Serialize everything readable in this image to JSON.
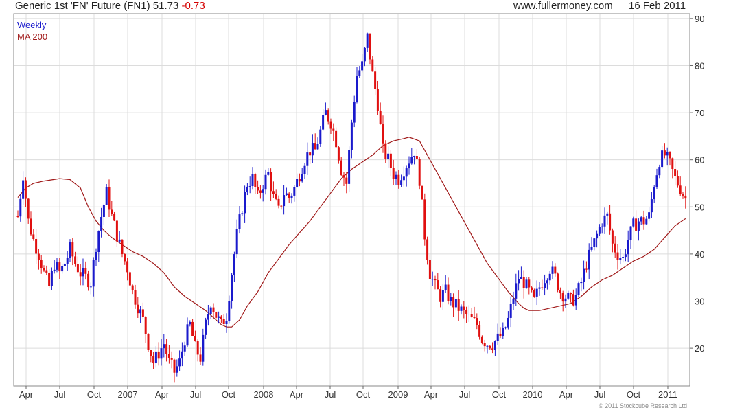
{
  "header": {
    "title_prefix": "Generic 1st 'FN' Future (FN1) 51.73",
    "title_change": "-0.73",
    "website": "www.fullermoney.com",
    "date": "16 Feb 2011"
  },
  "footer": {
    "copyright": "© 2011 Stockcube Research Ltd"
  },
  "colors": {
    "up": "#1a1acc",
    "down": "#e01010",
    "ma": "#a01818",
    "grid": "#dcdcdc",
    "legend_weekly": "#1a1acc",
    "legend_ma": "#a01818"
  },
  "chart_data": {
    "type": "candlestick",
    "legend": [
      "Weekly",
      "MA 200"
    ],
    "x_tick_labels": [
      "Apr",
      "Jul",
      "Oct",
      "2007",
      "Apr",
      "Jul",
      "Oct",
      "2008",
      "Apr",
      "Jul",
      "Oct",
      "2009",
      "Apr",
      "Jul",
      "Oct",
      "2010",
      "Apr",
      "Jul",
      "Oct",
      "2011"
    ],
    "y_ticks": [
      20,
      30,
      40,
      50,
      60,
      70,
      80,
      90
    ],
    "ylim": [
      12,
      91
    ],
    "grid": true,
    "last_close": 51.73,
    "change": -0.73,
    "weeks_total": 257,
    "close_series": [
      {
        "w": 0,
        "c": 48
      },
      {
        "w": 2,
        "c": 57
      },
      {
        "w": 4,
        "c": 47
      },
      {
        "w": 6,
        "c": 43
      },
      {
        "w": 8,
        "c": 40
      },
      {
        "w": 10,
        "c": 36
      },
      {
        "w": 12,
        "c": 33
      },
      {
        "w": 14,
        "c": 38
      },
      {
        "w": 16,
        "c": 36
      },
      {
        "w": 18,
        "c": 38
      },
      {
        "w": 20,
        "c": 41
      },
      {
        "w": 22,
        "c": 38
      },
      {
        "w": 24,
        "c": 36
      },
      {
        "w": 26,
        "c": 35
      },
      {
        "w": 28,
        "c": 34
      },
      {
        "w": 30,
        "c": 42
      },
      {
        "w": 32,
        "c": 48
      },
      {
        "w": 34,
        "c": 53
      },
      {
        "w": 36,
        "c": 48
      },
      {
        "w": 38,
        "c": 44
      },
      {
        "w": 40,
        "c": 40
      },
      {
        "w": 42,
        "c": 37
      },
      {
        "w": 44,
        "c": 32
      },
      {
        "w": 46,
        "c": 29
      },
      {
        "w": 48,
        "c": 26
      },
      {
        "w": 50,
        "c": 21
      },
      {
        "w": 52,
        "c": 17
      },
      {
        "w": 54,
        "c": 19
      },
      {
        "w": 56,
        "c": 21
      },
      {
        "w": 58,
        "c": 17
      },
      {
        "w": 60,
        "c": 15
      },
      {
        "w": 62,
        "c": 17
      },
      {
        "w": 64,
        "c": 22
      },
      {
        "w": 66,
        "c": 25
      },
      {
        "w": 68,
        "c": 20
      },
      {
        "w": 70,
        "c": 18
      },
      {
        "w": 72,
        "c": 25
      },
      {
        "w": 74,
        "c": 30
      },
      {
        "w": 76,
        "c": 27
      },
      {
        "w": 78,
        "c": 25
      },
      {
        "w": 80,
        "c": 27
      },
      {
        "w": 82,
        "c": 36
      },
      {
        "w": 84,
        "c": 44
      },
      {
        "w": 86,
        "c": 50
      },
      {
        "w": 88,
        "c": 55
      },
      {
        "w": 90,
        "c": 56
      },
      {
        "w": 92,
        "c": 52
      },
      {
        "w": 94,
        "c": 55
      },
      {
        "w": 96,
        "c": 57
      },
      {
        "w": 98,
        "c": 52
      },
      {
        "w": 100,
        "c": 49
      },
      {
        "w": 102,
        "c": 53
      },
      {
        "w": 104,
        "c": 52
      },
      {
        "w": 106,
        "c": 54
      },
      {
        "w": 108,
        "c": 57
      },
      {
        "w": 110,
        "c": 60
      },
      {
        "w": 112,
        "c": 62
      },
      {
        "w": 114,
        "c": 62
      },
      {
        "w": 116,
        "c": 66
      },
      {
        "w": 118,
        "c": 70
      },
      {
        "w": 120,
        "c": 68
      },
      {
        "w": 122,
        "c": 64
      },
      {
        "w": 124,
        "c": 58
      },
      {
        "w": 126,
        "c": 55
      },
      {
        "w": 128,
        "c": 68
      },
      {
        "w": 130,
        "c": 78
      },
      {
        "w": 132,
        "c": 80
      },
      {
        "w": 134,
        "c": 86
      },
      {
        "w": 136,
        "c": 78
      },
      {
        "w": 138,
        "c": 72
      },
      {
        "w": 140,
        "c": 62
      },
      {
        "w": 142,
        "c": 60
      },
      {
        "w": 144,
        "c": 57
      },
      {
        "w": 146,
        "c": 56
      },
      {
        "w": 148,
        "c": 58
      },
      {
        "w": 150,
        "c": 60
      },
      {
        "w": 152,
        "c": 62
      },
      {
        "w": 154,
        "c": 56
      },
      {
        "w": 156,
        "c": 44
      },
      {
        "w": 158,
        "c": 36
      },
      {
        "w": 160,
        "c": 33
      },
      {
        "w": 162,
        "c": 31
      },
      {
        "w": 164,
        "c": 32
      },
      {
        "w": 166,
        "c": 30
      },
      {
        "w": 168,
        "c": 29
      },
      {
        "w": 170,
        "c": 28
      },
      {
        "w": 172,
        "c": 27
      },
      {
        "w": 174,
        "c": 26
      },
      {
        "w": 176,
        "c": 25
      },
      {
        "w": 178,
        "c": 22
      },
      {
        "w": 180,
        "c": 21
      },
      {
        "w": 182,
        "c": 21
      },
      {
        "w": 184,
        "c": 22
      },
      {
        "w": 186,
        "c": 23
      },
      {
        "w": 188,
        "c": 26
      },
      {
        "w": 190,
        "c": 31
      },
      {
        "w": 192,
        "c": 35
      },
      {
        "w": 194,
        "c": 34
      },
      {
        "w": 196,
        "c": 32
      },
      {
        "w": 198,
        "c": 30
      },
      {
        "w": 200,
        "c": 33
      },
      {
        "w": 202,
        "c": 35
      },
      {
        "w": 204,
        "c": 37
      },
      {
        "w": 206,
        "c": 35
      },
      {
        "w": 208,
        "c": 32
      },
      {
        "w": 210,
        "c": 31
      },
      {
        "w": 212,
        "c": 30
      },
      {
        "w": 214,
        "c": 31
      },
      {
        "w": 216,
        "c": 34
      },
      {
        "w": 218,
        "c": 38
      },
      {
        "w": 220,
        "c": 41
      },
      {
        "w": 222,
        "c": 44
      },
      {
        "w": 224,
        "c": 47
      },
      {
        "w": 226,
        "c": 48
      },
      {
        "w": 228,
        "c": 42
      },
      {
        "w": 230,
        "c": 40
      },
      {
        "w": 232,
        "c": 39
      },
      {
        "w": 234,
        "c": 43
      },
      {
        "w": 236,
        "c": 46
      },
      {
        "w": 238,
        "c": 47
      },
      {
        "w": 240,
        "c": 47
      },
      {
        "w": 242,
        "c": 48
      },
      {
        "w": 244,
        "c": 55
      },
      {
        "w": 246,
        "c": 60
      },
      {
        "w": 248,
        "c": 61
      },
      {
        "w": 250,
        "c": 59
      },
      {
        "w": 252,
        "c": 56
      },
      {
        "w": 254,
        "c": 54
      },
      {
        "w": 256,
        "c": 51.73
      }
    ],
    "ma_series": [
      {
        "w": 0,
        "v": 52
      },
      {
        "w": 3,
        "v": 54
      },
      {
        "w": 6,
        "v": 55
      },
      {
        "w": 10,
        "v": 55.5
      },
      {
        "w": 16,
        "v": 56
      },
      {
        "w": 20,
        "v": 55.8
      },
      {
        "w": 24,
        "v": 54
      },
      {
        "w": 27,
        "v": 50
      },
      {
        "w": 30,
        "v": 47
      },
      {
        "w": 33,
        "v": 45
      },
      {
        "w": 36,
        "v": 43.5
      },
      {
        "w": 40,
        "v": 42
      },
      {
        "w": 44,
        "v": 40.5
      },
      {
        "w": 48,
        "v": 39.5
      },
      {
        "w": 52,
        "v": 38
      },
      {
        "w": 56,
        "v": 36
      },
      {
        "w": 60,
        "v": 33
      },
      {
        "w": 64,
        "v": 31
      },
      {
        "w": 68,
        "v": 29.5
      },
      {
        "w": 72,
        "v": 28
      },
      {
        "w": 75,
        "v": 26.5
      },
      {
        "w": 78,
        "v": 25
      },
      {
        "w": 80,
        "v": 24.5
      },
      {
        "w": 82,
        "v": 24.5
      },
      {
        "w": 85,
        "v": 26
      },
      {
        "w": 88,
        "v": 29
      },
      {
        "w": 92,
        "v": 32
      },
      {
        "w": 96,
        "v": 36
      },
      {
        "w": 100,
        "v": 39
      },
      {
        "w": 104,
        "v": 42
      },
      {
        "w": 108,
        "v": 44.5
      },
      {
        "w": 112,
        "v": 47
      },
      {
        "w": 116,
        "v": 50
      },
      {
        "w": 120,
        "v": 53
      },
      {
        "w": 124,
        "v": 56
      },
      {
        "w": 128,
        "v": 58
      },
      {
        "w": 132,
        "v": 59.5
      },
      {
        "w": 136,
        "v": 61
      },
      {
        "w": 140,
        "v": 63
      },
      {
        "w": 144,
        "v": 64
      },
      {
        "w": 148,
        "v": 64.5
      },
      {
        "w": 150,
        "v": 64.8
      },
      {
        "w": 154,
        "v": 64
      },
      {
        "w": 156,
        "v": 62
      },
      {
        "w": 160,
        "v": 58
      },
      {
        "w": 164,
        "v": 54
      },
      {
        "w": 168,
        "v": 50
      },
      {
        "w": 172,
        "v": 46
      },
      {
        "w": 176,
        "v": 42
      },
      {
        "w": 180,
        "v": 38
      },
      {
        "w": 184,
        "v": 35
      },
      {
        "w": 188,
        "v": 32
      },
      {
        "w": 192,
        "v": 29.5
      },
      {
        "w": 194,
        "v": 28.5
      },
      {
        "w": 196,
        "v": 28
      },
      {
        "w": 200,
        "v": 28
      },
      {
        "w": 204,
        "v": 28.5
      },
      {
        "w": 208,
        "v": 29
      },
      {
        "w": 212,
        "v": 29.5
      },
      {
        "w": 216,
        "v": 31
      },
      {
        "w": 220,
        "v": 33
      },
      {
        "w": 224,
        "v": 34.5
      },
      {
        "w": 228,
        "v": 35.5
      },
      {
        "w": 232,
        "v": 37
      },
      {
        "w": 236,
        "v": 38.5
      },
      {
        "w": 240,
        "v": 39.5
      },
      {
        "w": 244,
        "v": 41
      },
      {
        "w": 248,
        "v": 43.5
      },
      {
        "w": 252,
        "v": 46
      },
      {
        "w": 256,
        "v": 47.5
      }
    ]
  }
}
